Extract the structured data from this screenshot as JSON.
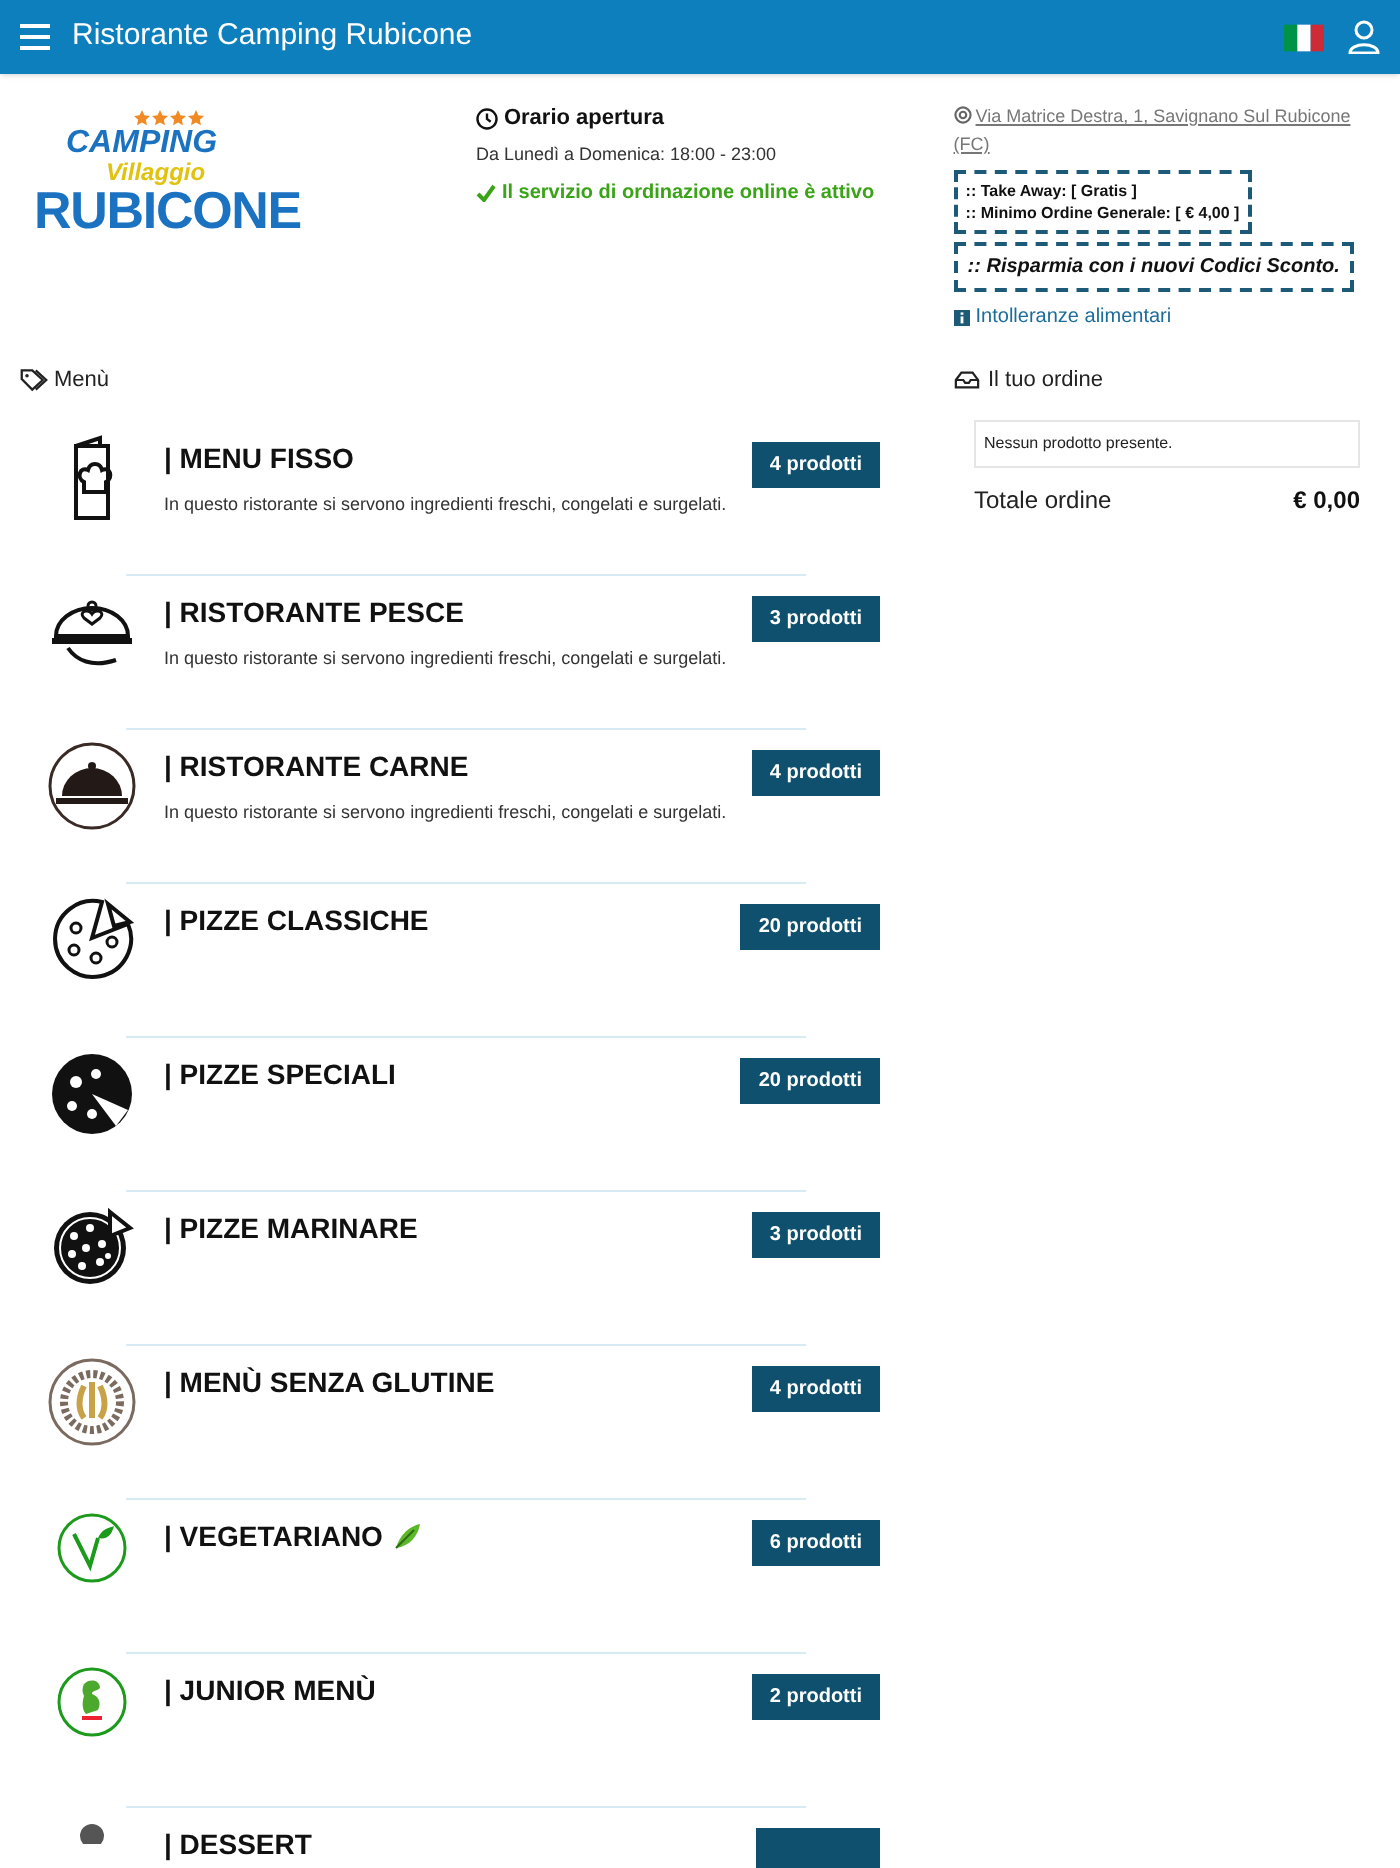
{
  "header": {
    "title": "Ristorante Camping Rubicone"
  },
  "logo": {
    "top": "CAMPING",
    "middle": "Villaggio",
    "bottom": "RUBICONE",
    "stars": 4
  },
  "hours": {
    "title": "Orario apertura",
    "text": "Da Lunedì a Domenica: 18:00 - 23:00",
    "status": "Il servizio di ordinazione online è attivo"
  },
  "info": {
    "address": "Via Matrice Destra, 1, Savignano Sul Rubicone (FC)",
    "conditions": [
      ":: Take Away: [ Gratis ]",
      ":: Minimo Ordine Generale: [ € 4,00 ]"
    ],
    "promo": ":: Risparmia con i nuovi Codici Sconto.",
    "allergens_link": "Intolleranze alimentari"
  },
  "menu": {
    "heading": "Menù",
    "categories": [
      {
        "title": "| MENU FISSO",
        "description": "In questo ristorante si servono ingredienti freschi, congelati e surgelati.",
        "count": "4 prodotti",
        "leaf_icon": false
      },
      {
        "title": "| RISTORANTE PESCE",
        "description": "In questo ristorante si servono ingredienti freschi, congelati e surgelati.",
        "count": "3 prodotti",
        "leaf_icon": false
      },
      {
        "title": "| RISTORANTE CARNE",
        "description": "In questo ristorante si servono ingredienti freschi, congelati e surgelati.",
        "count": "4 prodotti",
        "leaf_icon": false
      },
      {
        "title": "| PIZZE CLASSICHE",
        "count": "20 prodotti",
        "leaf_icon": false
      },
      {
        "title": "| PIZZE SPECIALI",
        "count": "20 prodotti",
        "leaf_icon": false
      },
      {
        "title": "| PIZZE MARINARE",
        "count": "3 prodotti",
        "leaf_icon": false
      },
      {
        "title": "| MENÙ SENZA GLUTINE",
        "count": "4 prodotti",
        "leaf_icon": false
      },
      {
        "title": "| VEGETARIANO",
        "count": "6 prodotti",
        "leaf_icon": true
      },
      {
        "title": "| JUNIOR MENÙ",
        "count": "2 prodotti",
        "leaf_icon": false
      },
      {
        "title": "| DESSERT",
        "leaf_icon": false
      }
    ]
  },
  "order": {
    "heading": "Il tuo ordine",
    "empty": "Nessun prodotto presente.",
    "total_label": "Totale ordine",
    "total": "€ 0,00"
  }
}
